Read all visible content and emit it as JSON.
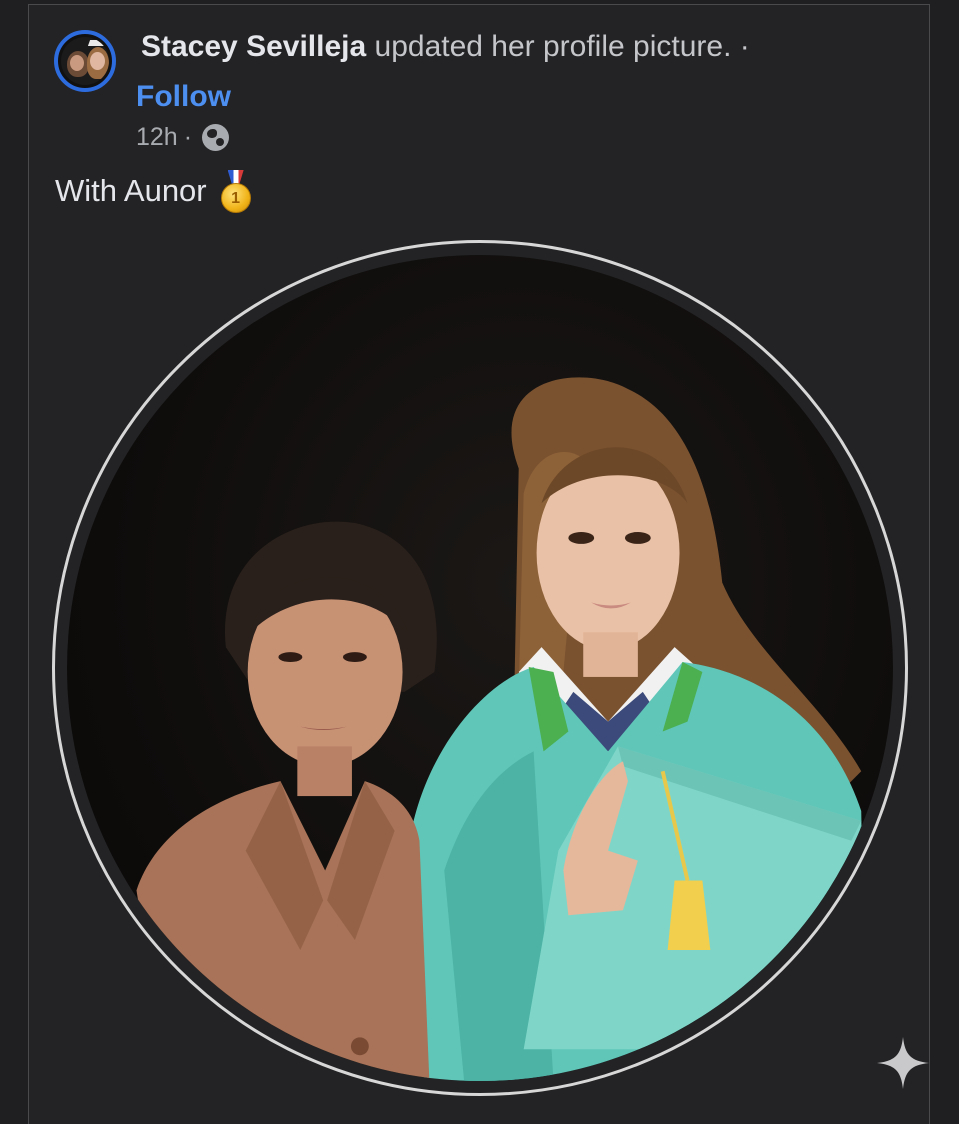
{
  "post": {
    "author_name": "Stacey Sevilleja",
    "action_text": "updated her profile picture.",
    "separator": "·",
    "follow_label": "Follow",
    "time": "12h",
    "time_separator": "·",
    "audience_icon": "globe-icon",
    "caption_text": "With Aunor",
    "caption_emoji": "first-place-medal-icon",
    "medal_number": "1"
  },
  "photo": {
    "kind": "circular-profile-picture",
    "subjects": [
      "woman-in-brown-blazer",
      "graduate-in-teal-toga-holding-cap"
    ]
  },
  "overlay_icon": "sparkle-icon",
  "colors": {
    "background": "#232325",
    "follow_link": "#4d8ff0",
    "avatar_ring": "#2d6cdf",
    "photo_ring": "#d7d7d7"
  }
}
